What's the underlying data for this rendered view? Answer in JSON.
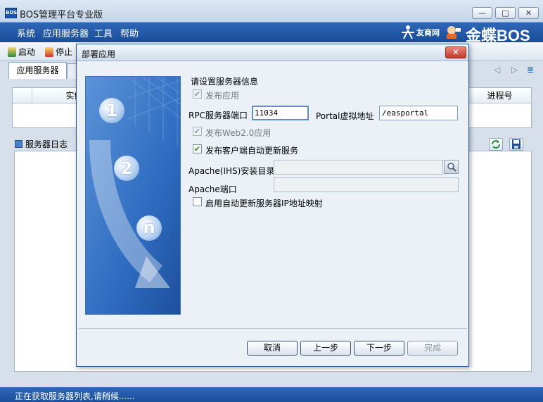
{
  "window": {
    "title": "BOS管理平台专业版",
    "icon_text": "BOS",
    "controls": {
      "minimize": "—",
      "maximize": "□",
      "close": "✕"
    }
  },
  "menubar": {
    "items": [
      {
        "label": "系统"
      },
      {
        "label": "应用服务器"
      },
      {
        "label": "工具"
      },
      {
        "label": "帮助"
      }
    ],
    "brand_yh": "友商网",
    "brand_kd": "金蝶BOS"
  },
  "toolbar": {
    "start_label": "启动",
    "stop_label": "停止"
  },
  "tabs": [
    {
      "label": "应用服务器",
      "active": true
    }
  ],
  "server_table": {
    "columns": [
      "实例",
      "进程号"
    ]
  },
  "log_panel": {
    "title": "服务器日志"
  },
  "statusbar": {
    "text": "正在获取服务器列表,请稍候......"
  },
  "dialog": {
    "title": "部署应用",
    "close_glyph": "✕",
    "wizard_steps": [
      "1",
      "2",
      "n"
    ],
    "section_title": "请设置服务器信息",
    "publish_app": {
      "label": "发布应用",
      "checked": true,
      "enabled": false
    },
    "rpc_port": {
      "label": "RPC服务器端口",
      "value": "11034"
    },
    "portal": {
      "label": "Portal虚拟地址",
      "value": "/easportal"
    },
    "publish_web20": {
      "label": "发布Web2.0应用",
      "checked": true,
      "enabled": false
    },
    "publish_client_update": {
      "label": "发布客户端自动更新服务",
      "checked": true,
      "enabled": true
    },
    "apache_dir": {
      "label": "Apache(IHS)安装目录",
      "value": ""
    },
    "apache_port": {
      "label": "Apache端口",
      "value": ""
    },
    "auto_update_ip_mapping": {
      "label": "启用自动更新服务器IP地址映射",
      "checked": false
    },
    "buttons": {
      "cancel": "取消",
      "prev": "上一步",
      "next": "下一步",
      "finish": "完成"
    }
  },
  "colors": {
    "menubar_blue": "#1f56a3",
    "dialog_bg": "#ecf1f7",
    "close_red": "#c43b28",
    "check_green": "#2d7d2d"
  }
}
